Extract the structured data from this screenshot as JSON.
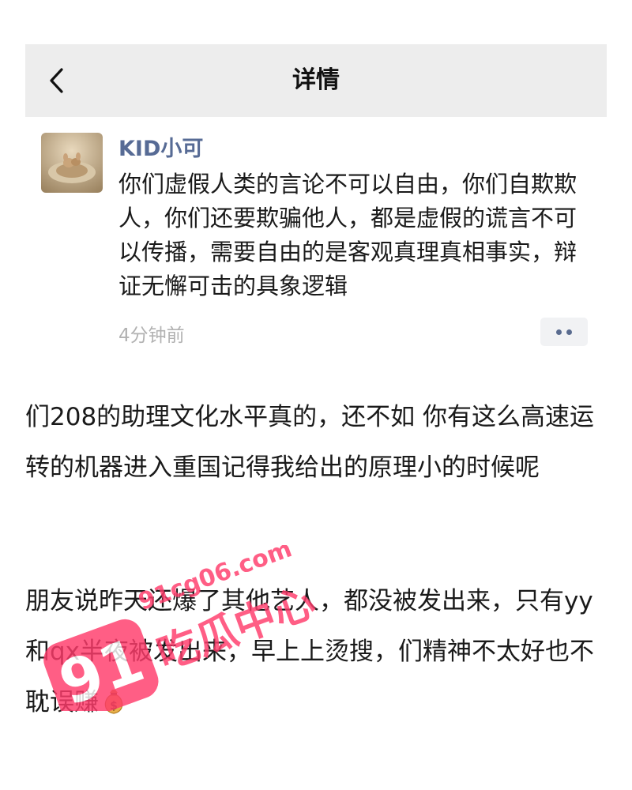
{
  "navbar": {
    "title": "详情",
    "back_icon": "chevron-left-icon"
  },
  "comment": {
    "username": "KID小可",
    "text": "你们虚假人类的言论不可以自由，你们自欺欺人，你们还要欺骗他人，都是虚假的谎言不可以传播，需要自由的是客观真理真相事实，辩证无懈可击的具象逻辑",
    "timestamp": "4分钟前",
    "more_icon": "more-dots-icon",
    "username_color": "#576b95"
  },
  "paragraphs": [
    {
      "text": "们208的助理文化水平真的，还不如 你有这么高速运转的机器进入重国记得我给出的原理小的时候呢"
    },
    {
      "text": "朋友说昨天还爆了其他艺人，都没被发出来，只有yy和qx半夜被发出来，早上上烫搜，们精神不太好也不耽误赚",
      "trailing_icon": "money-bag-icon"
    }
  ],
  "watermark": {
    "domain": "91cg06.com",
    "number": "91",
    "label": "吃瓜中心",
    "color": "#ff3b6b"
  }
}
